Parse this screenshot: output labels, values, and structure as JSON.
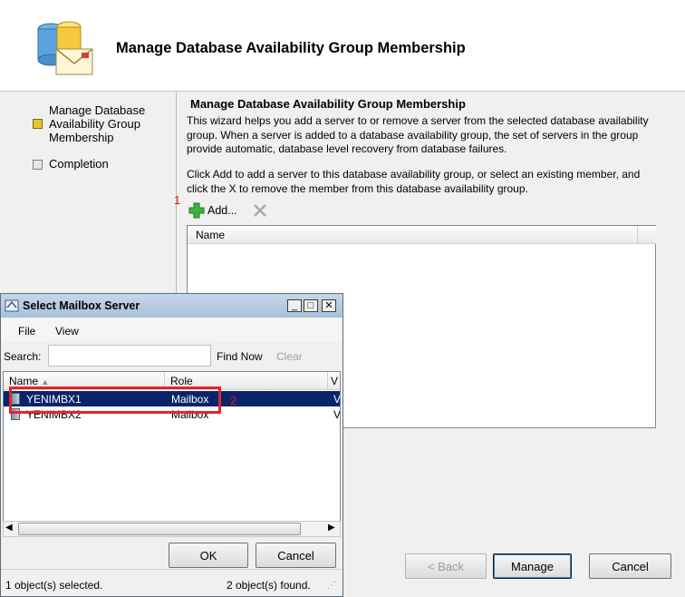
{
  "wizard": {
    "title": "Manage Database Availability Group Membership",
    "steps": [
      {
        "label": "Manage Database Availability Group Membership",
        "active": true
      },
      {
        "label": "Completion",
        "active": false
      }
    ],
    "main_title": "Manage Database Availability Group Membership",
    "description": "This wizard helps you add a server to or remove a server from the selected database availability group. When a server is added to a database availability group, the set of servers in the group provide automatic, database level recovery from database failures.",
    "instructions": "Click Add to add a server to this database availability group, or select an existing member, and click the X to remove the member from this database availability group.",
    "add_label": "Add...",
    "list_header": "Name",
    "buttons": {
      "back": "< Back",
      "manage": "Manage",
      "cancel": "Cancel"
    }
  },
  "annotations": {
    "step1": "1",
    "step2": "2"
  },
  "dialog": {
    "title": "Select Mailbox Server",
    "menu": [
      "File",
      "View"
    ],
    "search_label": "Search:",
    "search_value": "",
    "find_now": "Find Now",
    "clear": "Clear",
    "columns": [
      "Name",
      "Role",
      "V"
    ],
    "rows": [
      {
        "name": "YENIMBX1",
        "role": "Mailbox",
        "v": "V",
        "selected": true
      },
      {
        "name": "YENIMBX2",
        "role": "Mailbox",
        "v": "V",
        "selected": false
      }
    ],
    "ok": "OK",
    "cancel": "Cancel",
    "status_selected": "1 object(s) selected.",
    "status_found": "2 object(s) found."
  },
  "colors": {
    "selection": "#0a246a",
    "annotation": "#e0262c",
    "step_active": "#e8c52a"
  }
}
